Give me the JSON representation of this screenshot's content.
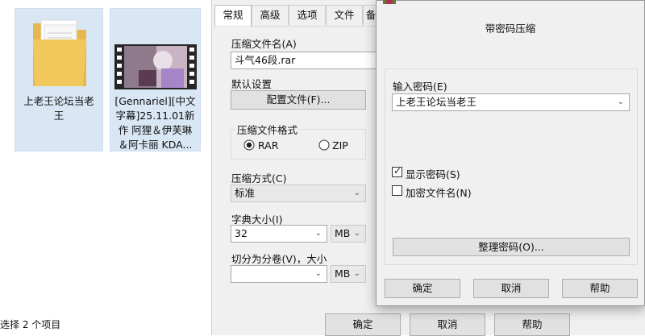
{
  "explorer": {
    "items": [
      {
        "label_line1": "上老王论坛当老",
        "label_line2": "王"
      },
      {
        "label_line1": "[Gennariel][中文",
        "label_line2": "字幕]25.11.01新",
        "label_line3": "作 阿狸＆伊芙琳",
        "label_line4": "＆阿卡丽 KDA..."
      }
    ],
    "status": "选择 2 个项目"
  },
  "archive": {
    "tabs": [
      "常规",
      "高级",
      "选项",
      "文件",
      "备"
    ],
    "filename_label": "压缩文件名(A)",
    "filename_value": "斗气46段.rar",
    "default_settings_label": "默认设置",
    "profile_button": "配置文件(F)...",
    "format_label": "压缩文件格式",
    "format_rar": "RAR",
    "format_zip": "ZIP",
    "method_label": "压缩方式(C)",
    "method_value": "标准",
    "dict_label": "字典大小(I)",
    "dict_value": "32",
    "dict_unit": "MB",
    "split_label": "切分为分卷(V)，大小",
    "split_value": "",
    "split_unit": "MB",
    "ok": "确定",
    "cancel": "取消",
    "help": "帮助"
  },
  "password": {
    "title": "带密码压缩",
    "enter_label": "输入密码(E)",
    "password_value": "上老王论坛当老王",
    "show_password": "显示密码(S)",
    "show_password_checked": true,
    "encrypt_names": "加密文件名(N)",
    "encrypt_names_checked": false,
    "organize_button": "整理密码(O)...",
    "ok": "确定",
    "cancel": "取消",
    "help": "帮助"
  }
}
